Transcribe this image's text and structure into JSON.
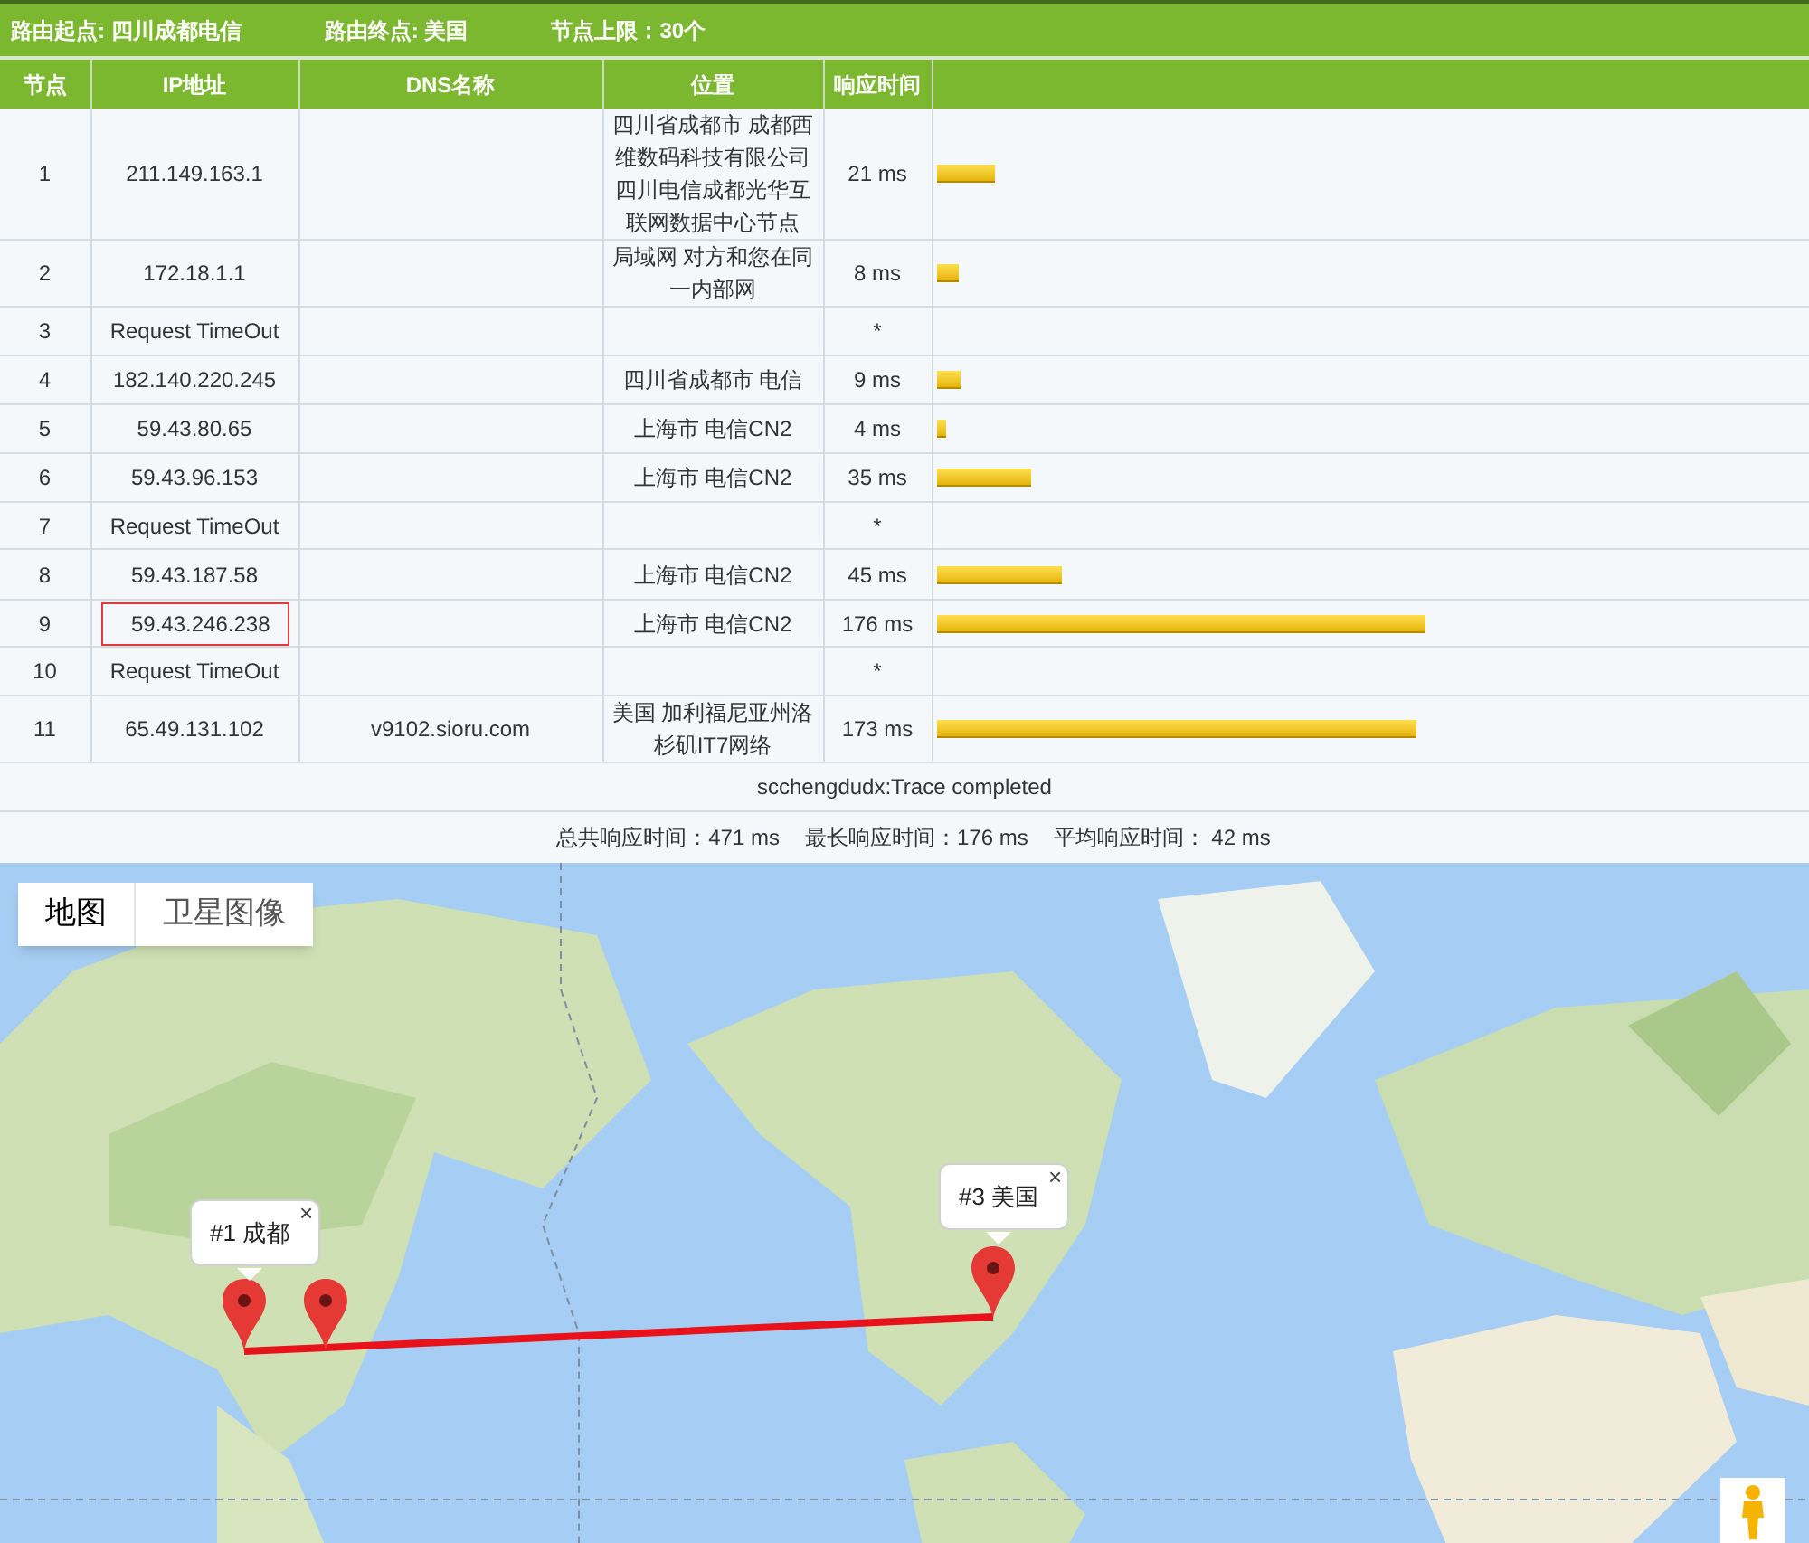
{
  "route_bar": [
    {
      "label": "路由起点: 四川成都电信"
    },
    {
      "label": "路由终点: 美国"
    },
    {
      "label": "节点上限：30个"
    }
  ],
  "table": {
    "columns": [
      "节点",
      "IP地址",
      "DNS名称",
      "位置",
      "响应时间"
    ],
    "rows": [
      {
        "hop": "1",
        "ip": "211.149.163.1",
        "location": "四川省成都市 成都西维数码科技有限公司四川电信成都光华互联网数据中心节点",
        "time": "21 ms",
        "level": 0.067,
        "highlighted": false
      },
      {
        "hop": "2",
        "ip": "172.18.1.1",
        "location": "局域网 对方和您在同一内部网",
        "time": "8 ms",
        "level": 0.026,
        "highlighted": false
      },
      {
        "hop": "3",
        "ip": "Request TimeOut",
        "time": "*",
        "highlighted": false
      },
      {
        "hop": "4",
        "ip": "182.140.220.245",
        "location": "四川省成都市 电信",
        "time": "9 ms",
        "level": 0.029,
        "highlighted": false
      },
      {
        "hop": "5",
        "ip": "59.43.80.65",
        "location": "上海市 电信CN2",
        "time": "4 ms",
        "level": 0.012,
        "highlighted": false
      },
      {
        "hop": "6",
        "ip": "59.43.96.153",
        "location": "上海市 电信CN2",
        "time": "35 ms",
        "level": 0.11,
        "highlighted": false
      },
      {
        "hop": "7",
        "ip": "Request TimeOut",
        "time": "*",
        "highlighted": false
      },
      {
        "hop": "8",
        "ip": "59.43.187.58",
        "location": "上海市 电信CN2",
        "time": "45 ms",
        "level": 0.144,
        "highlighted": false
      },
      {
        "hop": "9",
        "ip": "59.43.246.238",
        "location": "上海市 电信CN2",
        "time": "176 ms",
        "level": 0.563,
        "highlighted": true
      },
      {
        "hop": "10",
        "ip": "Request TimeOut",
        "time": "*",
        "highlighted": false
      },
      {
        "hop": "11",
        "ip": "65.49.131.102",
        "dns": "v9102.sioru.com",
        "location": "美国 加利福尼亚州洛杉矶IT7网络",
        "time": "173 ms",
        "level": 0.553,
        "highlighted": false
      }
    ],
    "trace_status": "scchengdudx:Trace completed",
    "summary": [
      "总共响应时间：471 ms",
      "最长响应时间：176 ms",
      "平均响应时间： 42 ms"
    ]
  },
  "map": {
    "kind": "picture",
    "map_types": [
      {
        "label": "地图",
        "selected": true
      },
      {
        "label": "卫星图像",
        "selected": false
      }
    ],
    "info_windows": [
      {
        "label": "#1 成都",
        "close": "×"
      },
      {
        "label": "#3 美国",
        "close": "×"
      }
    ]
  }
}
